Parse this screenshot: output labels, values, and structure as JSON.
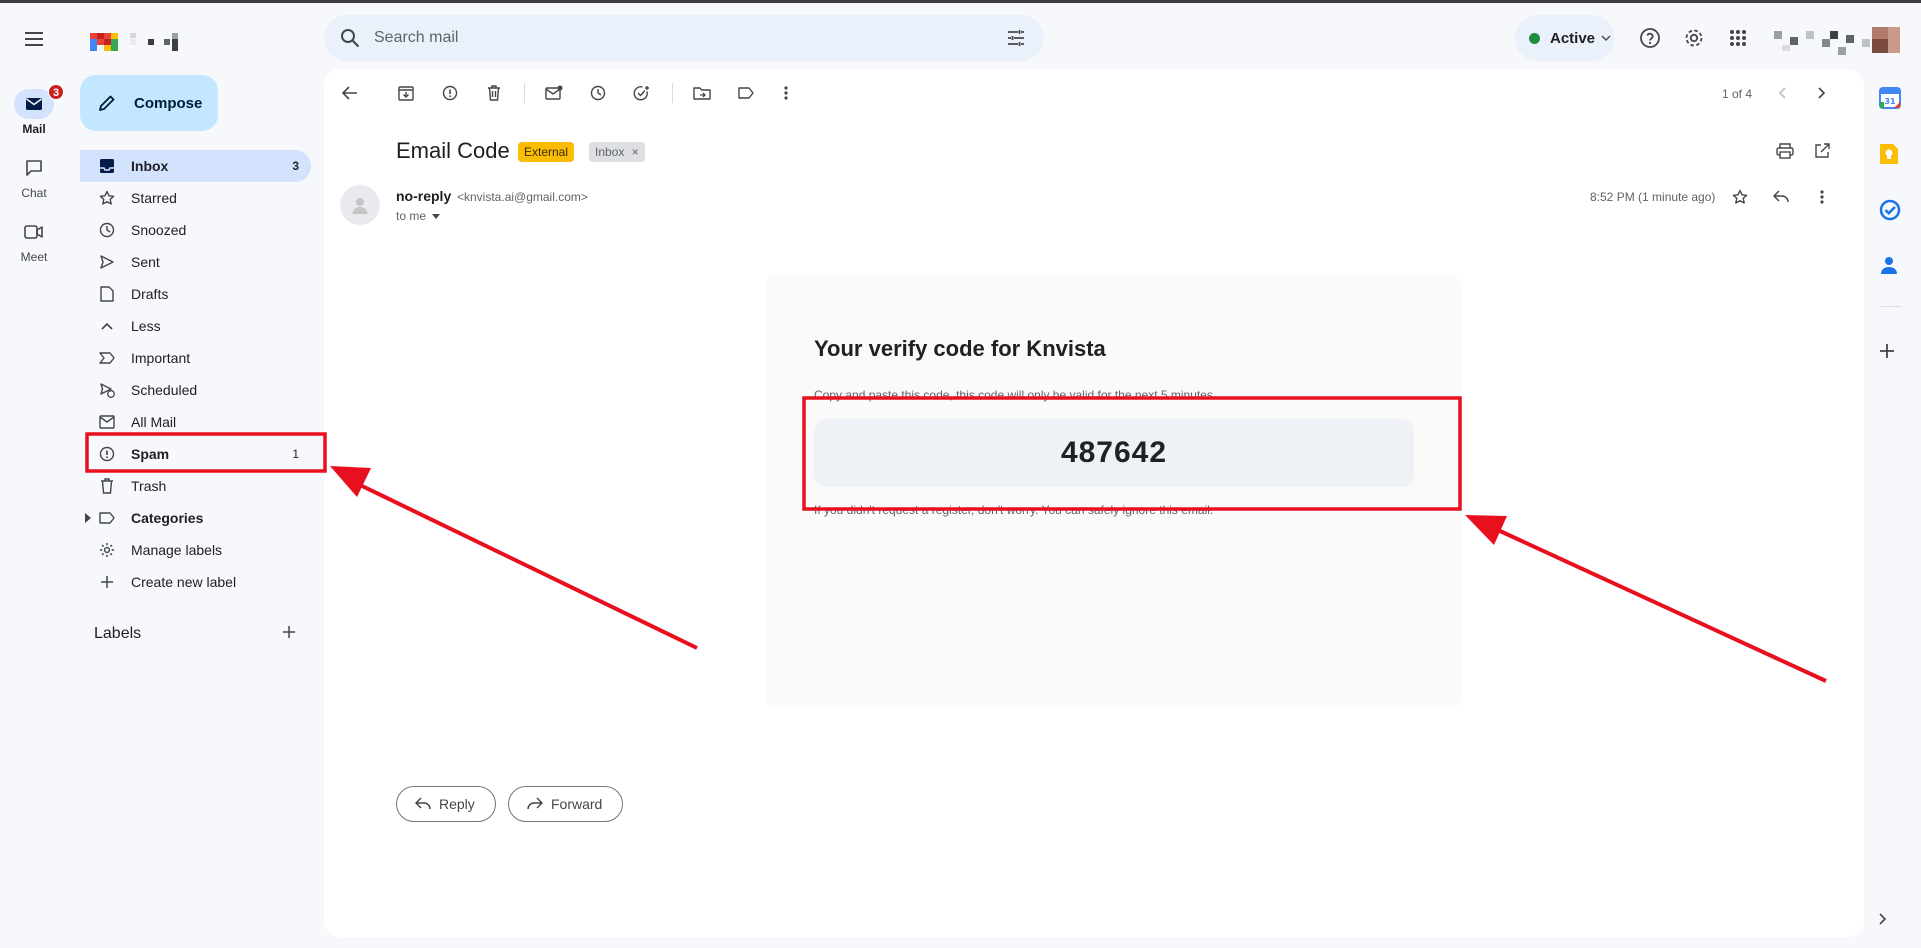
{
  "rail": {
    "items": [
      {
        "label": "Mail",
        "badge": "3"
      },
      {
        "label": "Chat"
      },
      {
        "label": "Meet"
      }
    ]
  },
  "compose": {
    "label": "Compose"
  },
  "sidebar": {
    "items": [
      {
        "label": "Inbox",
        "count": "3",
        "icon": "inbox-icon"
      },
      {
        "label": "Starred",
        "icon": "star-icon"
      },
      {
        "label": "Snoozed",
        "icon": "clock-icon"
      },
      {
        "label": "Sent",
        "icon": "send-icon"
      },
      {
        "label": "Drafts",
        "icon": "draft-icon"
      },
      {
        "label": "Less",
        "icon": "chevron-up-icon"
      },
      {
        "label": "Important",
        "icon": "important-icon"
      },
      {
        "label": "Scheduled",
        "icon": "scheduled-icon"
      },
      {
        "label": "All Mail",
        "icon": "all-mail-icon"
      },
      {
        "label": "Spam",
        "count": "1",
        "icon": "spam-icon"
      },
      {
        "label": "Trash",
        "icon": "trash-icon"
      },
      {
        "label": "Categories",
        "icon": "label-icon"
      },
      {
        "label": "Manage labels",
        "icon": "gear-icon"
      },
      {
        "label": "Create new label",
        "icon": "plus-icon"
      }
    ],
    "labels_heading": "Labels"
  },
  "search": {
    "placeholder": "Search mail"
  },
  "status": {
    "label": "Active"
  },
  "toolbar": {
    "pager": "1 of 4"
  },
  "email": {
    "subject": "Email Code",
    "tags": [
      "External",
      "Inbox"
    ],
    "sender_name": "no-reply",
    "sender_address": "<knvista.ai@gmail.com>",
    "recipient": "to me",
    "time": "8:52 PM (1 minute ago)",
    "body": {
      "heading": "Your verify code for Knvista",
      "instruction": "Copy and paste this code, this code will only be valid for the next 5 minutes.",
      "code": "487642",
      "footer": "If you didn't request a register, don't worry. You can safely ignore this email."
    }
  },
  "actions": {
    "reply": "Reply",
    "forward": "Forward"
  },
  "colors": {
    "annotation": "#e8101f",
    "accent": "#0b57d0",
    "selected": "#d3e3fd",
    "compose": "#c2e7ff"
  }
}
